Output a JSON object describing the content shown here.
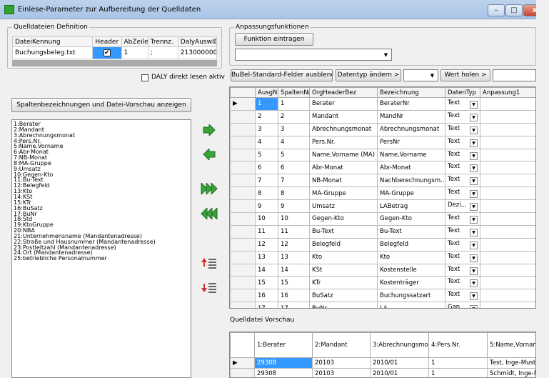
{
  "window": {
    "title": "Einlese-Parameter zur Aufbereitung der Quelldaten",
    "buttons": {
      "minimize": "–",
      "maximize": "□",
      "close": "x"
    }
  },
  "definition": {
    "group_label": "Quelldateien Definition",
    "columns": [
      "DateiKennung",
      "Header",
      "AbZeile",
      "Trennz.",
      "DalyAuswID"
    ],
    "row": {
      "datei": "Buchungsbeleg.txt",
      "header_checked": "✔",
      "abzeile": "1",
      "trennz": ";",
      "dalyauswid": "2130000004"
    },
    "daly_label": "DALY direkt lesen aktiv"
  },
  "anpassung": {
    "group_label": "Anpassungsfunktionen",
    "funktion_button": "Funktion eintragen",
    "combo_value": ""
  },
  "toolbar": {
    "bubel_button": "BuBel-Standard-Felder ausblend",
    "datentyp_button": "Datentyp ändern >",
    "datentyp_value": "",
    "wert_button": "Wert holen >",
    "wert_value": ""
  },
  "preview_button": "Spaltenbezeichnungen und Datei-Vorschau anzeigen",
  "field_list": [
    "1:Berater",
    "2:Mandant",
    "3:Abrechnungsmonat",
    "4:Pers.Nr.",
    "5:Name,Vorname",
    "6:Abr-Monat",
    "7:NB-Monat",
    "8:MA-Gruppe",
    "9:Umsatz",
    "10:Gegen-Kto",
    "11:Bu-Text",
    "12:Belegfeld",
    "13:Kto",
    "14:KSt",
    "15:KTr",
    "16:BuSatz",
    "17:BuNr",
    "18:Std",
    "19:KtoGruppe",
    "20:NBA",
    "21:Unternehmensname (Mandantenadresse)",
    "22:Straße und Hausnummer (Mandantenadresse)",
    "23:Postleitzahl (Mandantenadresse)",
    "24:Ort (Mandantenadresse)",
    "25:betriebliche Personalnummer"
  ],
  "grid": {
    "columns": [
      "AusgN",
      "SpaltenNr",
      "OrgHeaderBez",
      "Bezeichnung",
      "DatenTyp",
      "Anpassung1"
    ],
    "current_marker": "▶",
    "rows": [
      {
        "a": "1",
        "s": "1",
        "o": "Berater",
        "b": "BeraterNr",
        "d": "Text"
      },
      {
        "a": "2",
        "s": "2",
        "o": "Mandant",
        "b": "MandNr",
        "d": "Text"
      },
      {
        "a": "3",
        "s": "3",
        "o": "Abrechnungsmonat",
        "b": "Abrechnungsmonat",
        "d": "Text"
      },
      {
        "a": "4",
        "s": "4",
        "o": "Pers.Nr.",
        "b": "PersNr",
        "d": "Text"
      },
      {
        "a": "5",
        "s": "5",
        "o": "Name,Vorname (MA)",
        "b": "Name,Vorname",
        "d": "Text"
      },
      {
        "a": "6",
        "s": "6",
        "o": "Abr-Monat",
        "b": "Abr-Monat",
        "d": "Text"
      },
      {
        "a": "7",
        "s": "7",
        "o": "NB-Monat",
        "b": "Nachberechnungsm...",
        "d": "Text"
      },
      {
        "a": "8",
        "s": "8",
        "o": "MA-Gruppe",
        "b": "MA-Gruppe",
        "d": "Text"
      },
      {
        "a": "9",
        "s": "9",
        "o": "Umsatz",
        "b": "LABetrag",
        "d": "Dezi..."
      },
      {
        "a": "10",
        "s": "10",
        "o": "Gegen-Kto",
        "b": "Gegen-Kto",
        "d": "Text"
      },
      {
        "a": "11",
        "s": "11",
        "o": "Bu-Text",
        "b": "Bu-Text",
        "d": "Text"
      },
      {
        "a": "12",
        "s": "12",
        "o": "Belegfeld",
        "b": "Belegfeld",
        "d": "Text"
      },
      {
        "a": "13",
        "s": "13",
        "o": "Kto",
        "b": "Kto",
        "d": "Text"
      },
      {
        "a": "14",
        "s": "14",
        "o": "KSt",
        "b": "Kostenstelle",
        "d": "Text"
      },
      {
        "a": "15",
        "s": "15",
        "o": "KTr",
        "b": "Kostenträger",
        "d": "Text"
      },
      {
        "a": "16",
        "s": "16",
        "o": "BuSatz",
        "b": "Buchungssatzart",
        "d": "Text"
      },
      {
        "a": "17",
        "s": "17",
        "o": "BuNr",
        "b": "LA",
        "d": "Gan..."
      }
    ]
  },
  "vorschau": {
    "label": "Quelldatei Vorschau",
    "columns": [
      "1:Berater",
      "2:Mandant",
      "3:Abrechnungsmon",
      "4:Pers.Nr.",
      "5:Name,Vorname"
    ],
    "rows": [
      [
        "29308",
        "20103",
        "2010/01",
        "1",
        "Test, Inge-Muster"
      ],
      [
        "29308",
        "20103",
        "2010/01",
        "1",
        "Schmidt, Inge-Mu"
      ]
    ]
  }
}
